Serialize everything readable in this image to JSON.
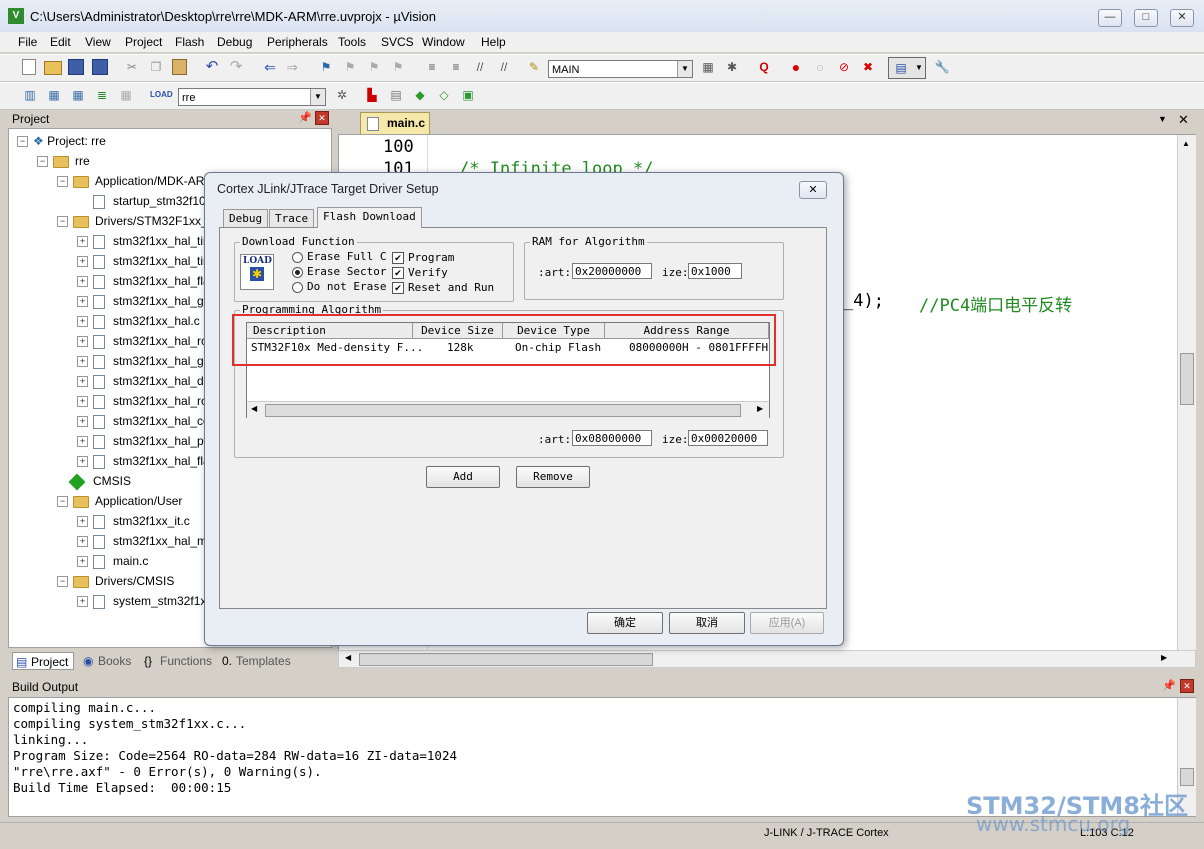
{
  "window": {
    "title": "C:\\Users\\Administrator\\Desktop\\rre\\rre\\MDK-ARM\\rre.uvprojx - µVision",
    "min": "—",
    "max": "□",
    "close": "✕"
  },
  "menu": [
    "File",
    "Edit",
    "View",
    "Project",
    "Flash",
    "Debug",
    "Peripherals",
    "Tools",
    "SVCS",
    "Window",
    "Help"
  ],
  "toolbar": {
    "target_combo": "MAIN",
    "project_combo": "rre"
  },
  "project_pane": {
    "title": "Project",
    "tree": [
      {
        "label": "Project: rre"
      },
      {
        "label": "rre"
      },
      {
        "label": "Application/MDK-ARM"
      },
      {
        "label": "startup_stm32f103xb.s"
      },
      {
        "label": "Drivers/STM32F1xx_HAL_Driver"
      },
      {
        "label": "stm32f1xx_hal_tim.c"
      },
      {
        "label": "stm32f1xx_hal_tim_ex.c"
      },
      {
        "label": "stm32f1xx_hal_flash.c"
      },
      {
        "label": "stm32f1xx_hal_gpio.c"
      },
      {
        "label": "stm32f1xx_hal.c"
      },
      {
        "label": "stm32f1xx_hal_rcc.c"
      },
      {
        "label": "stm32f1xx_hal_gpio_ex.c"
      },
      {
        "label": "stm32f1xx_hal_dma.c"
      },
      {
        "label": "stm32f1xx_hal_rcc_ex.c"
      },
      {
        "label": "stm32f1xx_hal_cortex.c"
      },
      {
        "label": "stm32f1xx_hal_pwr.c"
      },
      {
        "label": "stm32f1xx_hal_flash_ex.c"
      },
      {
        "label": "CMSIS"
      },
      {
        "label": "Application/User"
      },
      {
        "label": "stm32f1xx_it.c"
      },
      {
        "label": "stm32f1xx_hal_msp.c"
      },
      {
        "label": "main.c"
      },
      {
        "label": "Drivers/CMSIS"
      },
      {
        "label": "system_stm32f1xx.c"
      }
    ],
    "tabs": [
      "Project",
      "Books",
      "Functions",
      "Templates"
    ]
  },
  "editor": {
    "tab": "main.c",
    "lines": [
      {
        "num": "100",
        "code": ""
      },
      {
        "num": "101",
        "code": "/* Infinite loop */"
      }
    ],
    "code_fragment": "_4);",
    "comment": "//PC4端口电平反转"
  },
  "dialog": {
    "title": "Cortex JLink/JTrace Target Driver Setup",
    "tabs": [
      "Debug",
      "Trace",
      "Flash Download"
    ],
    "download_function": {
      "title": "Download Function",
      "load_icon_text": "LOAD",
      "radios": [
        "Erase Full C",
        "Erase Sector",
        "Do not Erase"
      ],
      "checks": [
        "Program",
        "Verify",
        "Reset and Run"
      ]
    },
    "ram": {
      "title": "RAM for Algorithm",
      "start_label": ":art:",
      "start": "0x20000000",
      "size_label": "ize:",
      "size": "0x1000"
    },
    "prog_algo": {
      "title": "Programming Algorithm",
      "columns": [
        "Description",
        "Device Size",
        "Device Type",
        "Address Range"
      ],
      "rows": [
        {
          "desc": "STM32F10x Med-density F...",
          "size": "128k",
          "type": "On-chip Flash",
          "range": "08000000H - 0801FFFFH"
        }
      ],
      "start_label": ":art:",
      "start": "0x08000000",
      "size_label": "ize:",
      "size": "0x00020000"
    },
    "buttons": {
      "add": "Add",
      "remove": "Remove",
      "ok": "确定",
      "cancel": "取消",
      "apply": "应用(A)"
    }
  },
  "build": {
    "title": "Build Output",
    "lines": [
      "compiling main.c...",
      "compiling system_stm32f1xx.c...",
      "linking...",
      "Program Size: Code=2564 RO-data=284 RW-data=16 ZI-data=1024",
      "\"rre\\rre.axf\" - 0 Error(s), 0 Warning(s).",
      "Build Time Elapsed:  00:00:15"
    ]
  },
  "status": {
    "debugger": "J-LINK / J-TRACE Cortex",
    "position": "L:103 C:12"
  },
  "watermark": {
    "line1": "STM32/STM8社区",
    "line2": "www.stmcu.org"
  }
}
